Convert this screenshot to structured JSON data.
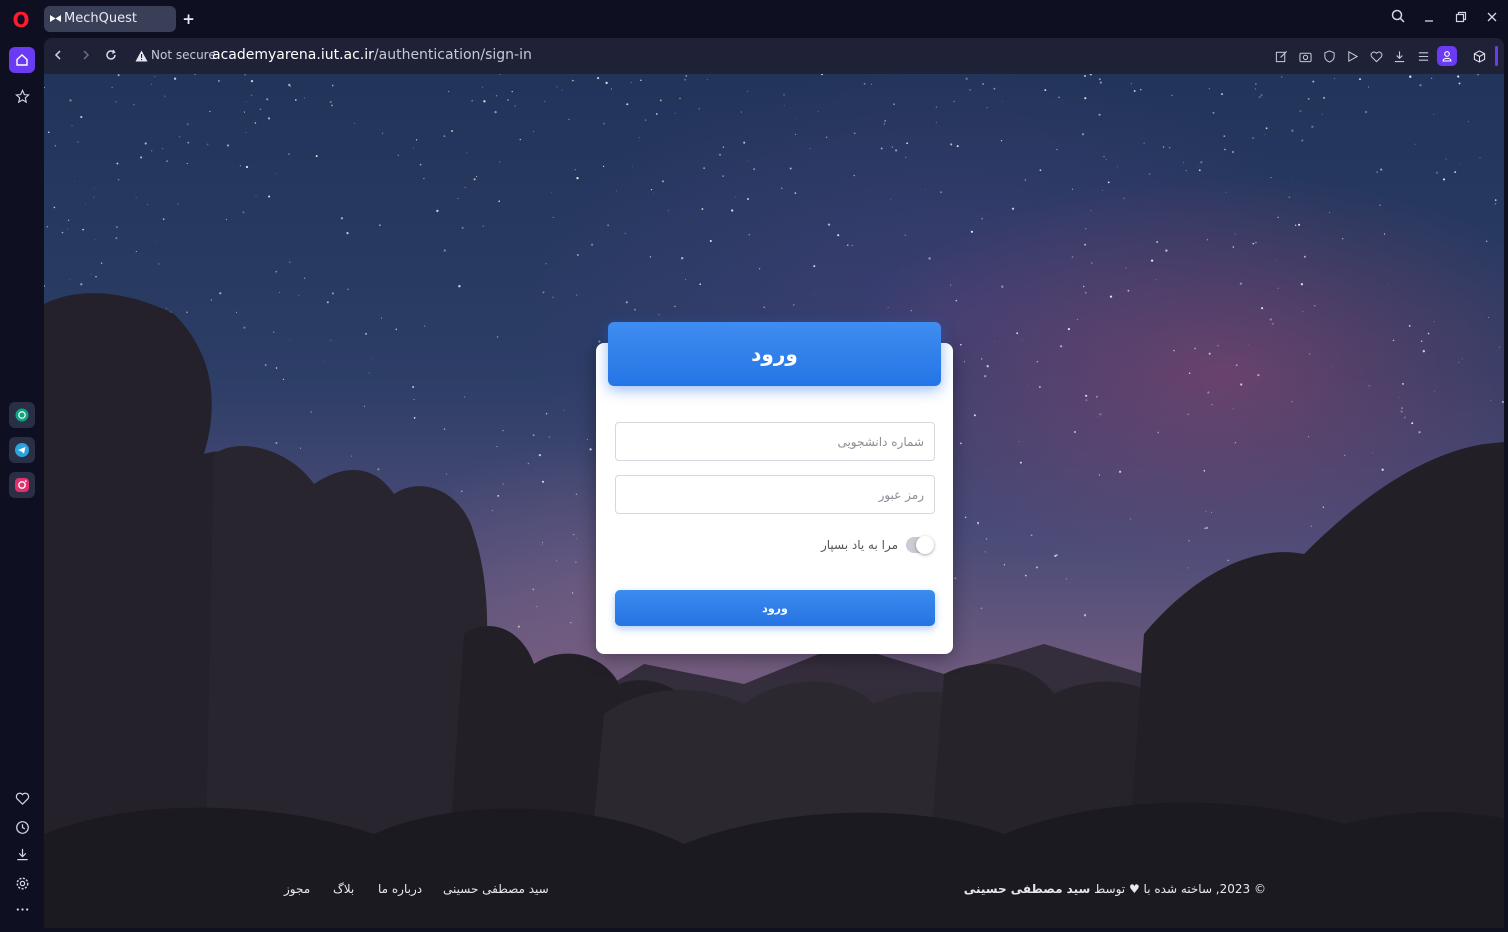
{
  "browser": {
    "tab_title": "MechQuest",
    "new_tab_symbol": "+",
    "url_security": "Not secure",
    "url_host_bold": "academyarena.iut.ac.ir",
    "url_path": "/authentication/sign-in",
    "brand_color": "#ff1b2d",
    "accent": "#6b3bf3"
  },
  "sidebar": {
    "top_items": [
      "home-icon",
      "bookmarks-icon"
    ],
    "apps": [
      "chatgpt-icon",
      "telegram-icon",
      "instagram-icon"
    ],
    "bottom_items": [
      "heart-icon",
      "history-icon",
      "downloads-icon",
      "settings-icon",
      "more-icon"
    ]
  },
  "login": {
    "title": "ورود",
    "student_id_placeholder": "شماره دانشجویی",
    "password_placeholder": "رمز عبور",
    "remember_label": "مرا به یاد بسپار",
    "remember_checked": false,
    "submit_label": "ورود",
    "accent": "#2f7fea"
  },
  "footer": {
    "links": [
      "سید مصطفی حسینی",
      "درباره ما",
      "بلاگ",
      "مجوز"
    ],
    "copyright_prefix": "© 2023, ساخته شده با",
    "copyright_by": "توسط",
    "copyright_author": "سید مصطفی حسینی"
  }
}
